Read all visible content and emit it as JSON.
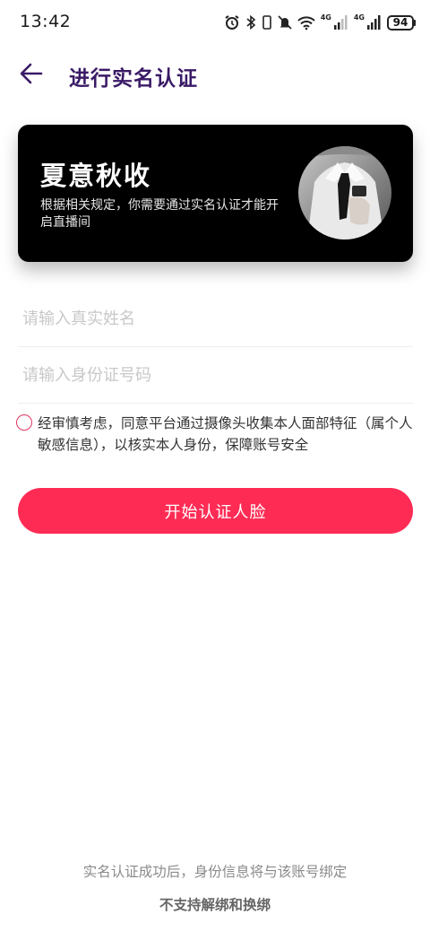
{
  "status_bar": {
    "time": "13:42",
    "icons": [
      "alarm-icon",
      "bluetooth-icon",
      "vibrate-icon",
      "mute-icon",
      "wifi-icon",
      "signal-4g-icon",
      "signal-4g-icon"
    ],
    "sim1_label": "4G",
    "sim2_label": "4G",
    "battery": "94"
  },
  "nav": {
    "back_icon": "arrow-left-icon",
    "title": "进行实名认证"
  },
  "card": {
    "name": "夏意秋收",
    "description": "根据相关规定，你需要通过实名认证才能开启直播间",
    "avatar": "avatar"
  },
  "form": {
    "name_placeholder": "请输入真实姓名",
    "name_value": "",
    "id_placeholder": "请输入身份证号码",
    "id_value": ""
  },
  "agreement": {
    "checked": false,
    "text": "经审慎考虑，同意平台通过摄像头收集本人面部特征（属个人敏感信息），以核实本人身份，保障账号安全"
  },
  "start_button": {
    "label": "开始认证人脸"
  },
  "footer": {
    "note": "实名认证成功后，身份信息将与该账号绑定",
    "warning": "不支持解绑和换绑"
  },
  "colors": {
    "accent": "#fe2c55",
    "title": "#3a1a66",
    "card_bg": "#000000"
  }
}
